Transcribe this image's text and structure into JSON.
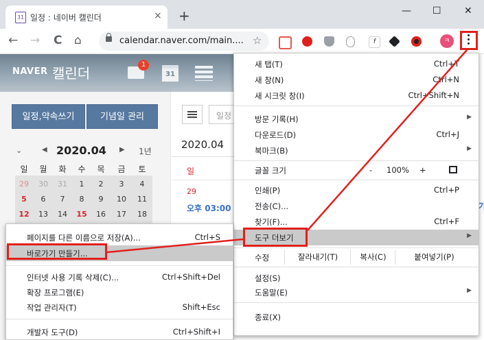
{
  "tab": {
    "title": "일정 : 네이버 캘린더",
    "favicon_text": "31",
    "close": "×",
    "new_tab": "+"
  },
  "window": {
    "minimize": "—",
    "maximize": "☐",
    "close": "✕"
  },
  "toolbar": {
    "back": "←",
    "forward": "→",
    "reload": "C",
    "home": "⌂",
    "url": "calendar.naver.com/main....",
    "star": "☆",
    "profile_initial": "ㅋ"
  },
  "header": {
    "logo": "NAVER",
    "title": "캘린더",
    "mail_badge": "1",
    "cal_icon_text": "31"
  },
  "sidebar": {
    "btn_schedule": "일정,약속쓰기",
    "btn_anniversary": "기념일 관리",
    "month_title": "2020.04",
    "year_link": "1년",
    "dow": [
      "일",
      "월",
      "화",
      "수",
      "목",
      "금",
      "토"
    ],
    "weeks": [
      [
        "29",
        "30",
        "31",
        "1",
        "2",
        "3",
        "4"
      ],
      [
        "5",
        "6",
        "7",
        "8",
        "9",
        "10",
        "11"
      ],
      [
        "12",
        "13",
        "14",
        "15",
        "16",
        "17",
        "18"
      ]
    ]
  },
  "main": {
    "search_placeholder": "일정",
    "date": "2020.04",
    "sun_label": "일",
    "day_29": "29",
    "time": "오후 03:00",
    "right_link": "가"
  },
  "chrome_menu": {
    "new_tab": {
      "label": "새 탭(T)",
      "shortcut": "Ctrl+T"
    },
    "new_window": {
      "label": "새 창(N)",
      "shortcut": "Ctrl+N"
    },
    "new_incognito": {
      "label": "새 시크릿 창(I)",
      "shortcut": "Ctrl+Shift+N"
    },
    "history": {
      "label": "방문 기록(H)"
    },
    "downloads": {
      "label": "다운로드(D)",
      "shortcut": "Ctrl+J"
    },
    "bookmarks": {
      "label": "북마크(B)"
    },
    "zoom": {
      "label": "글꼴 크기",
      "minus": "-",
      "value": "100%",
      "plus": "+"
    },
    "print": {
      "label": "인쇄(P)",
      "shortcut": "Ctrl+P"
    },
    "cast": {
      "label": "전송(C)..."
    },
    "find": {
      "label": "찾기(F)...",
      "shortcut": "Ctrl+F"
    },
    "more_tools": {
      "label": "도구 더보기"
    },
    "edit": {
      "label": "수정",
      "cut": "잘라내기(T)",
      "copy": "복사(C)",
      "paste": "붙여넣기(P)"
    },
    "settings": {
      "label": "설정(S)"
    },
    "help": {
      "label": "도움말(E)"
    },
    "exit": {
      "label": "종료(X)"
    }
  },
  "tools_menu": {
    "save_as": {
      "label": "페이지를 다른 이름으로 저장(A)...",
      "shortcut": "Ctrl+S"
    },
    "create_shortcut": {
      "label": "바로가기 만들기..."
    },
    "clear_data": {
      "label": "인터넷 사용 기록 삭제(C)...",
      "shortcut": "Ctrl+Shift+Del"
    },
    "extensions": {
      "label": "확장 프로그램(E)"
    },
    "task_manager": {
      "label": "작업 관리자(T)",
      "shortcut": "Shift+Esc"
    },
    "dev_tools": {
      "label": "개발자 도구(D)",
      "shortcut": "Ctrl+Shift+I"
    }
  },
  "colors": {
    "highlight_box": "#e0201b",
    "menu_highlight": "#cacaca",
    "brand_blue": "#5779a0",
    "sunday_red": "#d8252c"
  }
}
